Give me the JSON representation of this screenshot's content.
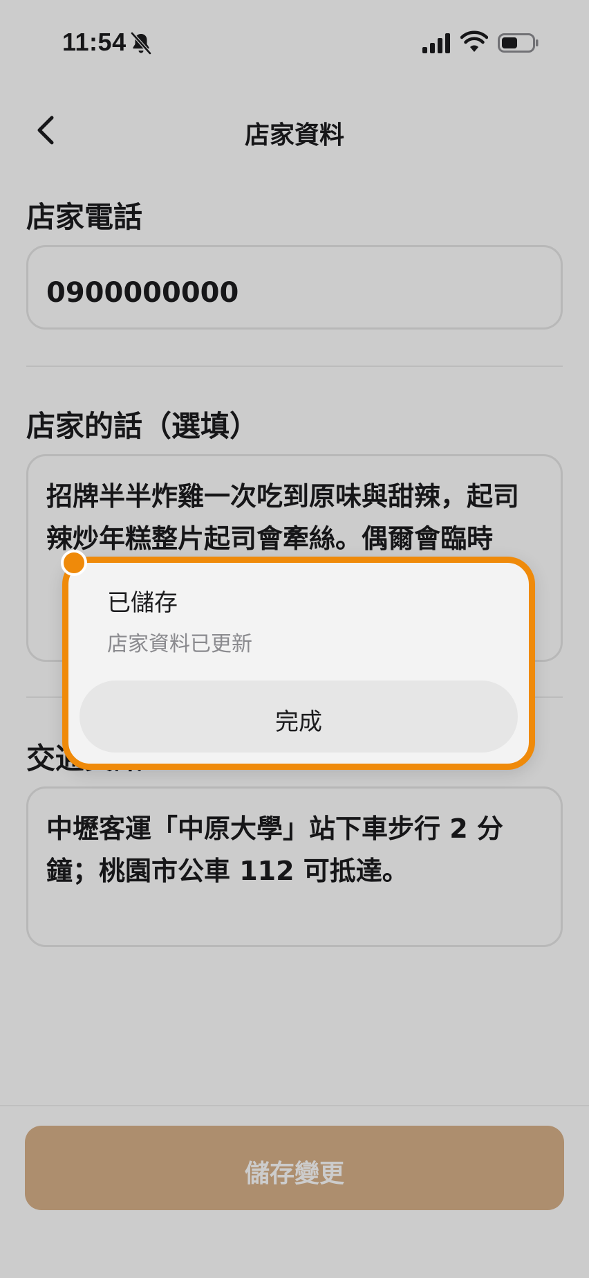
{
  "status_bar": {
    "time": "11:54",
    "icons": [
      "bell-slash-icon",
      "signal-icon",
      "wifi-icon",
      "battery-icon"
    ]
  },
  "nav": {
    "title": "店家資料",
    "back_icon": "chevron-left-icon"
  },
  "form": {
    "phone": {
      "label": "店家電話",
      "value": "0900000000"
    },
    "message": {
      "label": "店家的話（選填）",
      "value": "招牌半半炸雞一次吃到原味與甜辣，起司辣炒年糕整片起司會牽絲。偶爾會臨時"
    },
    "transport": {
      "label": "交通資訊",
      "value": "中壢客運「中原大學」站下車步行 2 分鐘；桃園市公車 112 可抵達。"
    }
  },
  "save_button": {
    "label": "儲存變更"
  },
  "dialog": {
    "title": "已儲存",
    "message": "店家資料已更新",
    "confirm_label": "完成"
  },
  "colors": {
    "accent": "#ef8a0a",
    "save_button": "#d9b28a",
    "overlay": "rgba(0,0,0,0.2)"
  }
}
